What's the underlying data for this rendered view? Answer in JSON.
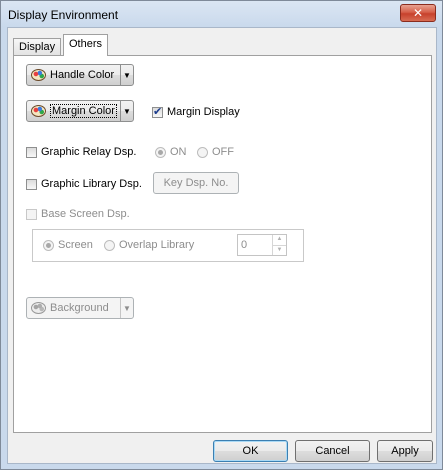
{
  "window": {
    "title": "Display Environment",
    "close_glyph": "✕"
  },
  "tabs": [
    {
      "label": "Display",
      "active": false
    },
    {
      "label": "Others",
      "active": true
    }
  ],
  "handle_color": {
    "label": "Handle Color",
    "icon": "palette-icon"
  },
  "margin_color": {
    "label": "Margin Color",
    "icon": "palette-icon"
  },
  "margin_display": {
    "label": "Margin Display",
    "checked": true
  },
  "graphic_relay": {
    "label": "Graphic Relay Dsp.",
    "checked": false
  },
  "relay_radio": {
    "on_label": "ON",
    "off_label": "OFF",
    "selected": "ON"
  },
  "graphic_library": {
    "label": "Graphic Library Dsp.",
    "checked": false
  },
  "key_dsp_button": {
    "label": "Key Dsp. No."
  },
  "base_screen": {
    "label": "Base Screen Dsp.",
    "checked": false,
    "enabled": false
  },
  "screen_group": {
    "screen_label": "Screen",
    "overlap_label": "Overlap Library",
    "selected": "Screen",
    "number_value": "0"
  },
  "background": {
    "label": "Background",
    "icon": "palette-icon"
  },
  "buttons": {
    "ok": "OK",
    "cancel": "Cancel",
    "apply": "Apply"
  },
  "colors": {
    "title_bar": "#c9d9ec",
    "close_button": "#c7412c",
    "panel": "#ffffff",
    "dialog_face": "#f0f0f0"
  }
}
